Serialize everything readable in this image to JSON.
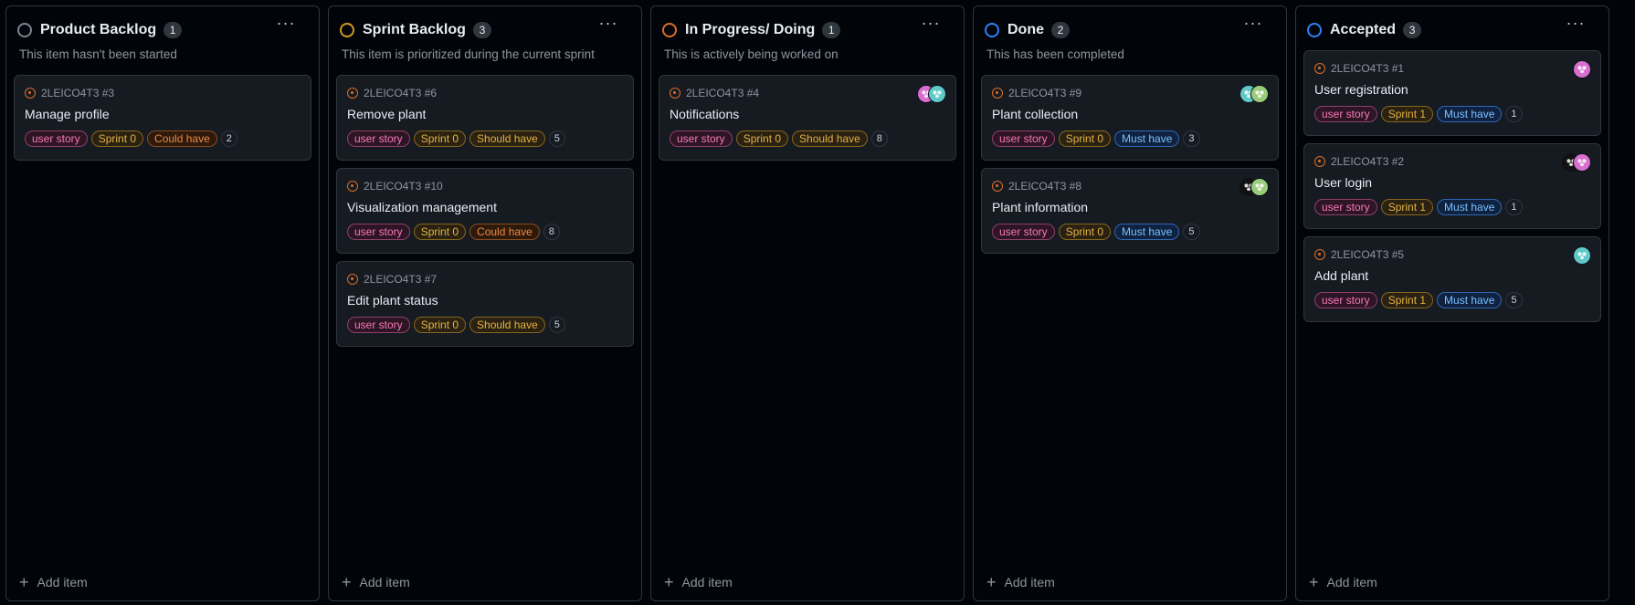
{
  "columns": [
    {
      "title": "Product Backlog",
      "count": "1",
      "ring_color": "#7d8590",
      "description": "This item hasn't been started",
      "add_label": "Add item",
      "cards": [
        {
          "ref": "2LEICO4T3 #3",
          "title": "Manage profile",
          "labels": [
            {
              "text": "user story",
              "kind": "story"
            },
            {
              "text": "Sprint 0",
              "kind": "sprint"
            },
            {
              "text": "Could have",
              "kind": "could"
            }
          ],
          "points": "2",
          "avatars": []
        }
      ]
    },
    {
      "title": "Sprint Backlog",
      "count": "3",
      "ring_color": "#d29922",
      "description": "This item is prioritized during the current sprint",
      "add_label": "Add item",
      "cards": [
        {
          "ref": "2LEICO4T3 #6",
          "title": "Remove plant",
          "labels": [
            {
              "text": "user story",
              "kind": "story"
            },
            {
              "text": "Sprint 0",
              "kind": "sprint"
            },
            {
              "text": "Should have",
              "kind": "should"
            }
          ],
          "points": "5",
          "avatars": []
        },
        {
          "ref": "2LEICO4T3 #10",
          "title": "Visualization management",
          "labels": [
            {
              "text": "user story",
              "kind": "story"
            },
            {
              "text": "Sprint 0",
              "kind": "sprint"
            },
            {
              "text": "Could have",
              "kind": "could"
            }
          ],
          "points": "8",
          "avatars": []
        },
        {
          "ref": "2LEICO4T3 #7",
          "title": "Edit plant status",
          "labels": [
            {
              "text": "user story",
              "kind": "story"
            },
            {
              "text": "Sprint 0",
              "kind": "sprint"
            },
            {
              "text": "Should have",
              "kind": "should"
            }
          ],
          "points": "5",
          "avatars": []
        }
      ]
    },
    {
      "title": "In Progress/ Doing",
      "count": "1",
      "ring_color": "#db6d28",
      "description": "This is actively being worked on",
      "add_label": "Add item",
      "cards": [
        {
          "ref": "2LEICO4T3 #4",
          "title": "Notifications",
          "labels": [
            {
              "text": "user story",
              "kind": "story"
            },
            {
              "text": "Sprint 0",
              "kind": "sprint"
            },
            {
              "text": "Should have",
              "kind": "should"
            }
          ],
          "points": "8",
          "avatars": [
            "pink",
            "teal"
          ]
        }
      ]
    },
    {
      "title": "Done",
      "count": "2",
      "ring_color": "#2f81f7",
      "description": "This has been completed",
      "add_label": "Add item",
      "cards": [
        {
          "ref": "2LEICO4T3 #9",
          "title": "Plant collection",
          "labels": [
            {
              "text": "user story",
              "kind": "story"
            },
            {
              "text": "Sprint 0",
              "kind": "sprint"
            },
            {
              "text": "Must have",
              "kind": "must"
            }
          ],
          "points": "3",
          "avatars": [
            "teal",
            "green"
          ]
        },
        {
          "ref": "2LEICO4T3 #8",
          "title": "Plant information",
          "labels": [
            {
              "text": "user story",
              "kind": "story"
            },
            {
              "text": "Sprint 0",
              "kind": "sprint"
            },
            {
              "text": "Must have",
              "kind": "must"
            }
          ],
          "points": "5",
          "avatars": [
            "dark",
            "green"
          ]
        }
      ]
    },
    {
      "title": "Accepted",
      "count": "3",
      "ring_color": "#2f81f7",
      "description": "",
      "add_label": "Add item",
      "cards": [
        {
          "ref": "2LEICO4T3 #1",
          "title": "User registration",
          "labels": [
            {
              "text": "user story",
              "kind": "story"
            },
            {
              "text": "Sprint 1",
              "kind": "sprint"
            },
            {
              "text": "Must have",
              "kind": "must"
            }
          ],
          "points": "1",
          "avatars": [
            "pink"
          ]
        },
        {
          "ref": "2LEICO4T3 #2",
          "title": "User login",
          "labels": [
            {
              "text": "user story",
              "kind": "story"
            },
            {
              "text": "Sprint 1",
              "kind": "sprint"
            },
            {
              "text": "Must have",
              "kind": "must"
            }
          ],
          "points": "1",
          "avatars": [
            "dark",
            "pink"
          ]
        },
        {
          "ref": "2LEICO4T3 #5",
          "title": "Add plant",
          "labels": [
            {
              "text": "user story",
              "kind": "story"
            },
            {
              "text": "Sprint 1",
              "kind": "sprint"
            },
            {
              "text": "Must have",
              "kind": "must"
            }
          ],
          "points": "5",
          "avatars": [
            "teal"
          ]
        }
      ]
    }
  ]
}
